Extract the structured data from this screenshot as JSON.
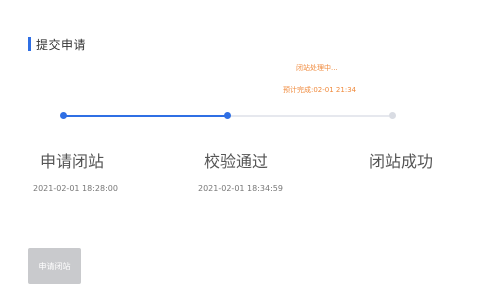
{
  "section": {
    "title": "提交申请"
  },
  "status_notes": {
    "line1": "闭站处理中...",
    "line2": "预计完成:02-01 21:34",
    "color": "#f08a3c"
  },
  "steps": [
    {
      "label": "申请闭站",
      "time": "2021-02-01 18:28:00",
      "state": "done"
    },
    {
      "label": "校验通过",
      "time": "2021-02-01 18:34:59",
      "state": "done"
    },
    {
      "label": "闭站成功",
      "time": "",
      "state": "pending"
    }
  ],
  "actions": {
    "apply_label": "申请闭站",
    "apply_disabled": true
  },
  "colors": {
    "accent": "#2f6fe4",
    "pending": "#d9dce3",
    "disabled_button": "#c9cacd"
  }
}
